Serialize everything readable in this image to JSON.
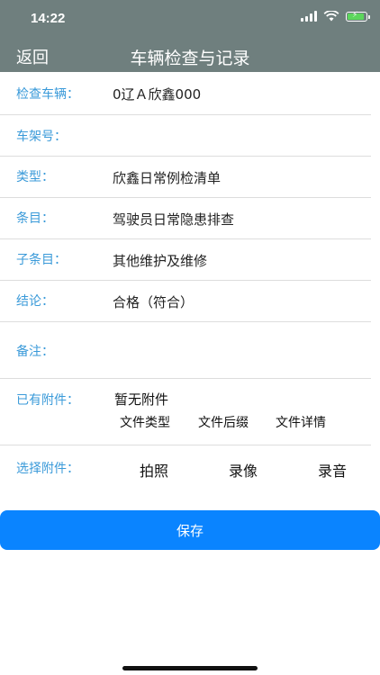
{
  "status": {
    "time": "14:22"
  },
  "nav": {
    "back_label": "返回",
    "title": "车辆检查与记录"
  },
  "form": {
    "vehicle": {
      "label": "检查车辆：",
      "value": "0辽Ａ欣鑫000"
    },
    "frame": {
      "label": "车架号：",
      "value": ""
    },
    "type": {
      "label": "类型：",
      "value": "欣鑫日常例检清单"
    },
    "item": {
      "label": "条目：",
      "value": "驾驶员日常隐患排查"
    },
    "subitem": {
      "label": "子条目：",
      "value": "其他维护及维修"
    },
    "conclusion": {
      "label": "结论：",
      "value": "合格（符合）"
    },
    "remark": {
      "label": "备注：",
      "value": ""
    },
    "attachments": {
      "label": "已有附件：",
      "empty_text": "暂无附件",
      "col_type": "文件类型",
      "col_suffix": "文件后缀",
      "col_detail": "文件详情"
    },
    "choose": {
      "label": "选择附件：",
      "photo": "拍照",
      "video": "录像",
      "audio": "录音"
    }
  },
  "save_label": "保存",
  "colors": {
    "nav_bg": "#6f7f7e",
    "label": "#3a9ad9",
    "primary": "#0a84ff"
  }
}
